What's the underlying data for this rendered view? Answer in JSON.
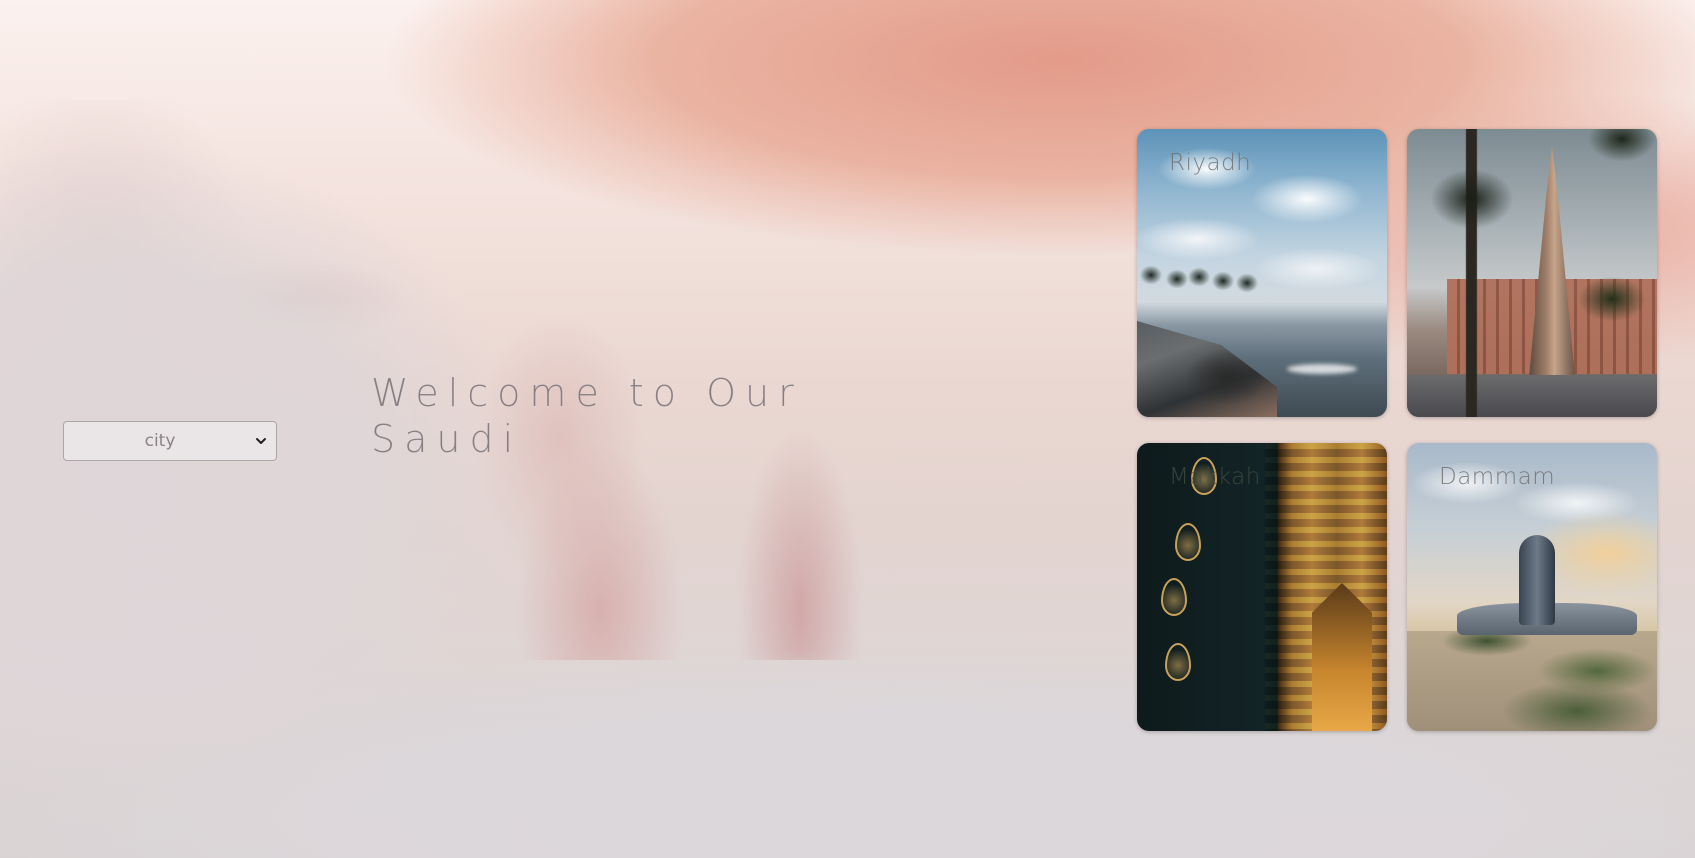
{
  "hero": {
    "title": "Welcome to Our Saudi"
  },
  "city_select": {
    "selected": "city",
    "icon": "chevron-down-icon"
  },
  "cards": [
    {
      "label": "Riyadh",
      "image": "coastal-corniche-photo"
    },
    {
      "label": "",
      "image": "faisaliah-tower-photo"
    },
    {
      "label": "Makkah",
      "image": "kaaba-door-photo"
    },
    {
      "label": "Dammam",
      "image": "ithra-center-photo"
    }
  ]
}
